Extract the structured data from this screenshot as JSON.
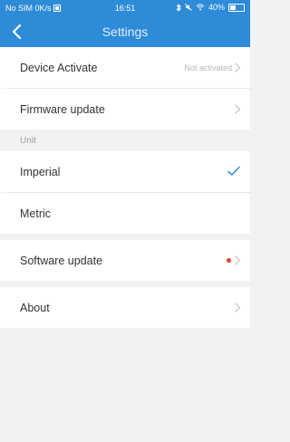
{
  "status_bar": {
    "carrier": "No SIM 0K/s",
    "time": "16:51",
    "battery_text": "40%"
  },
  "nav": {
    "title": "Settings"
  },
  "rows": {
    "device_activate": {
      "label": "Device Activate",
      "value": "Not activated"
    },
    "firmware_update": {
      "label": "Firmware update"
    },
    "unit_section": {
      "title": "Unit"
    },
    "imperial": {
      "label": "Imperial",
      "selected": true
    },
    "metric": {
      "label": "Metric",
      "selected": false
    },
    "software_update": {
      "label": "Software update",
      "has_badge": true
    },
    "about": {
      "label": "About"
    }
  },
  "colors": {
    "accent": "#2d8bd7",
    "badge": "#e53935",
    "check": "#2d8bd7"
  },
  "icons": {
    "back": "chevron-left-icon",
    "chevron": "chevron-right-icon",
    "check": "check-icon"
  }
}
